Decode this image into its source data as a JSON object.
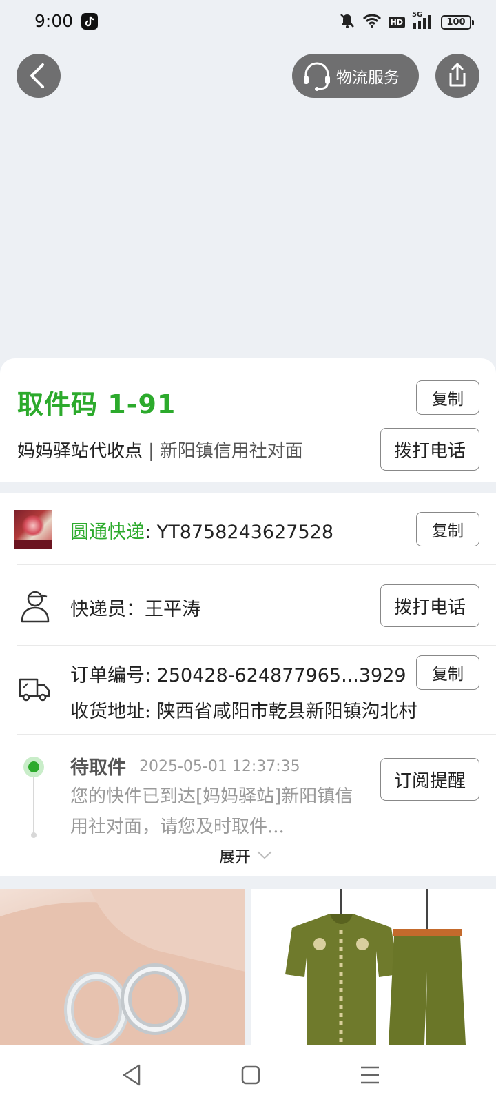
{
  "status_bar": {
    "time": "9:00",
    "network": "5G",
    "hd": "HD",
    "battery": "100",
    "icons": [
      "tiktok-icon",
      "mute-icon",
      "wifi-icon",
      "signal-icon",
      "battery-icon"
    ]
  },
  "nav": {
    "service_label": "物流服务"
  },
  "pickup": {
    "code": "取件码 1-91",
    "copy_label": "复制",
    "station": "妈妈驿站代收点",
    "separator": "|",
    "address": "新阳镇信用社对面",
    "call_label": "拨打电话"
  },
  "tracking": {
    "courier": "圆通快递",
    "colon": ":",
    "number": "YT8758243627528",
    "copy_label": "复制"
  },
  "courier_row": {
    "label": "快递员：王平涛",
    "call_label": "拨打电话"
  },
  "order": {
    "order_no": "订单编号: 250428-624877965...3929",
    "copy_label": "复制",
    "address": "收货地址: 陕西省咸阳市乾县新阳镇沟北村"
  },
  "status": {
    "title": "待取件",
    "time": "2025-05-01 12:37:35",
    "message": "您的快件已到达[妈妈驿站]新阳镇信用社对面，请您及时取件...",
    "subscribe_label": "订阅提醒",
    "expand_label": "展开"
  },
  "colors": {
    "accent_green": "#2caa2c",
    "nav_button_bg": "#6f6f70",
    "page_bg": "#edf0f4"
  }
}
